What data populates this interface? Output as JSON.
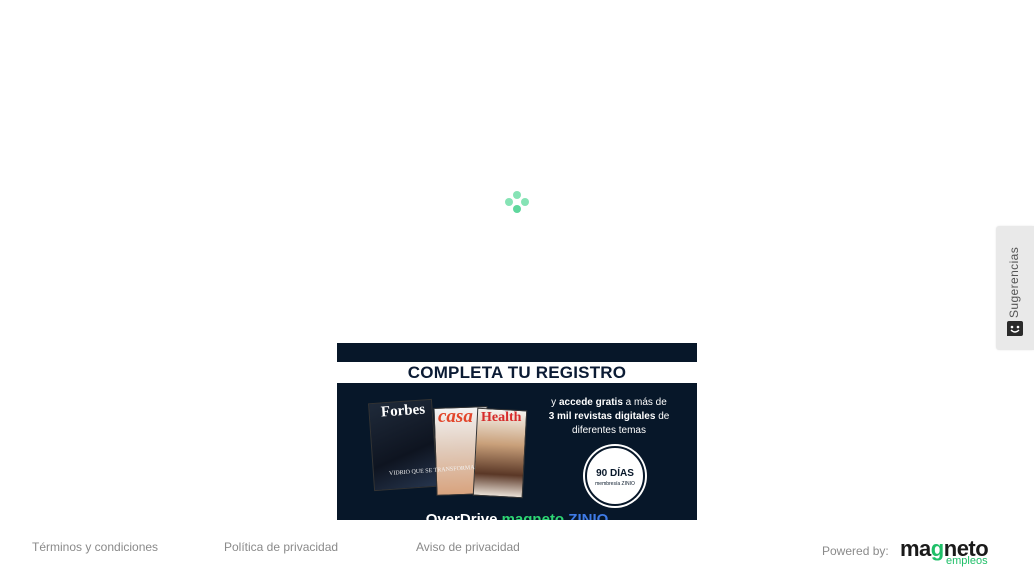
{
  "loader": {
    "icon": "loading-dots-icon",
    "color": "#5fd79d"
  },
  "sidebar_tab": {
    "label": "Sugerencias",
    "icon": "feedback-face-icon",
    "background": "#e9e9e9"
  },
  "banner": {
    "headline": "COMPLETA TU REGISTRO",
    "magazines": [
      "Forbes",
      "casa",
      "Health"
    ],
    "magazine_cover_text": "VIDRIO QUE SE TRANSFORMA",
    "copy": {
      "line1_prefix": "y",
      "line1_bold": "accede gratis",
      "line1_suffix": "a más de",
      "line2_bold": "3 mil revistas digitales",
      "line2_suffix": "de",
      "line3": "diferentes temas"
    },
    "badge": {
      "main": "90 DÍAS",
      "sub": "membresía ZINIO"
    },
    "brands": [
      "OverDrive",
      "magneto",
      "ZINIO"
    ],
    "background": "#071729"
  },
  "footer": {
    "links": [
      "Términos y condiciones",
      "Política de privacidad",
      "Aviso de privacidad"
    ],
    "powered_by": "Powered by:",
    "logo": {
      "word_dark": "ma",
      "word_green": "g",
      "word_rest": "neto",
      "sub": "empleos",
      "green": "#1fbf68"
    }
  }
}
